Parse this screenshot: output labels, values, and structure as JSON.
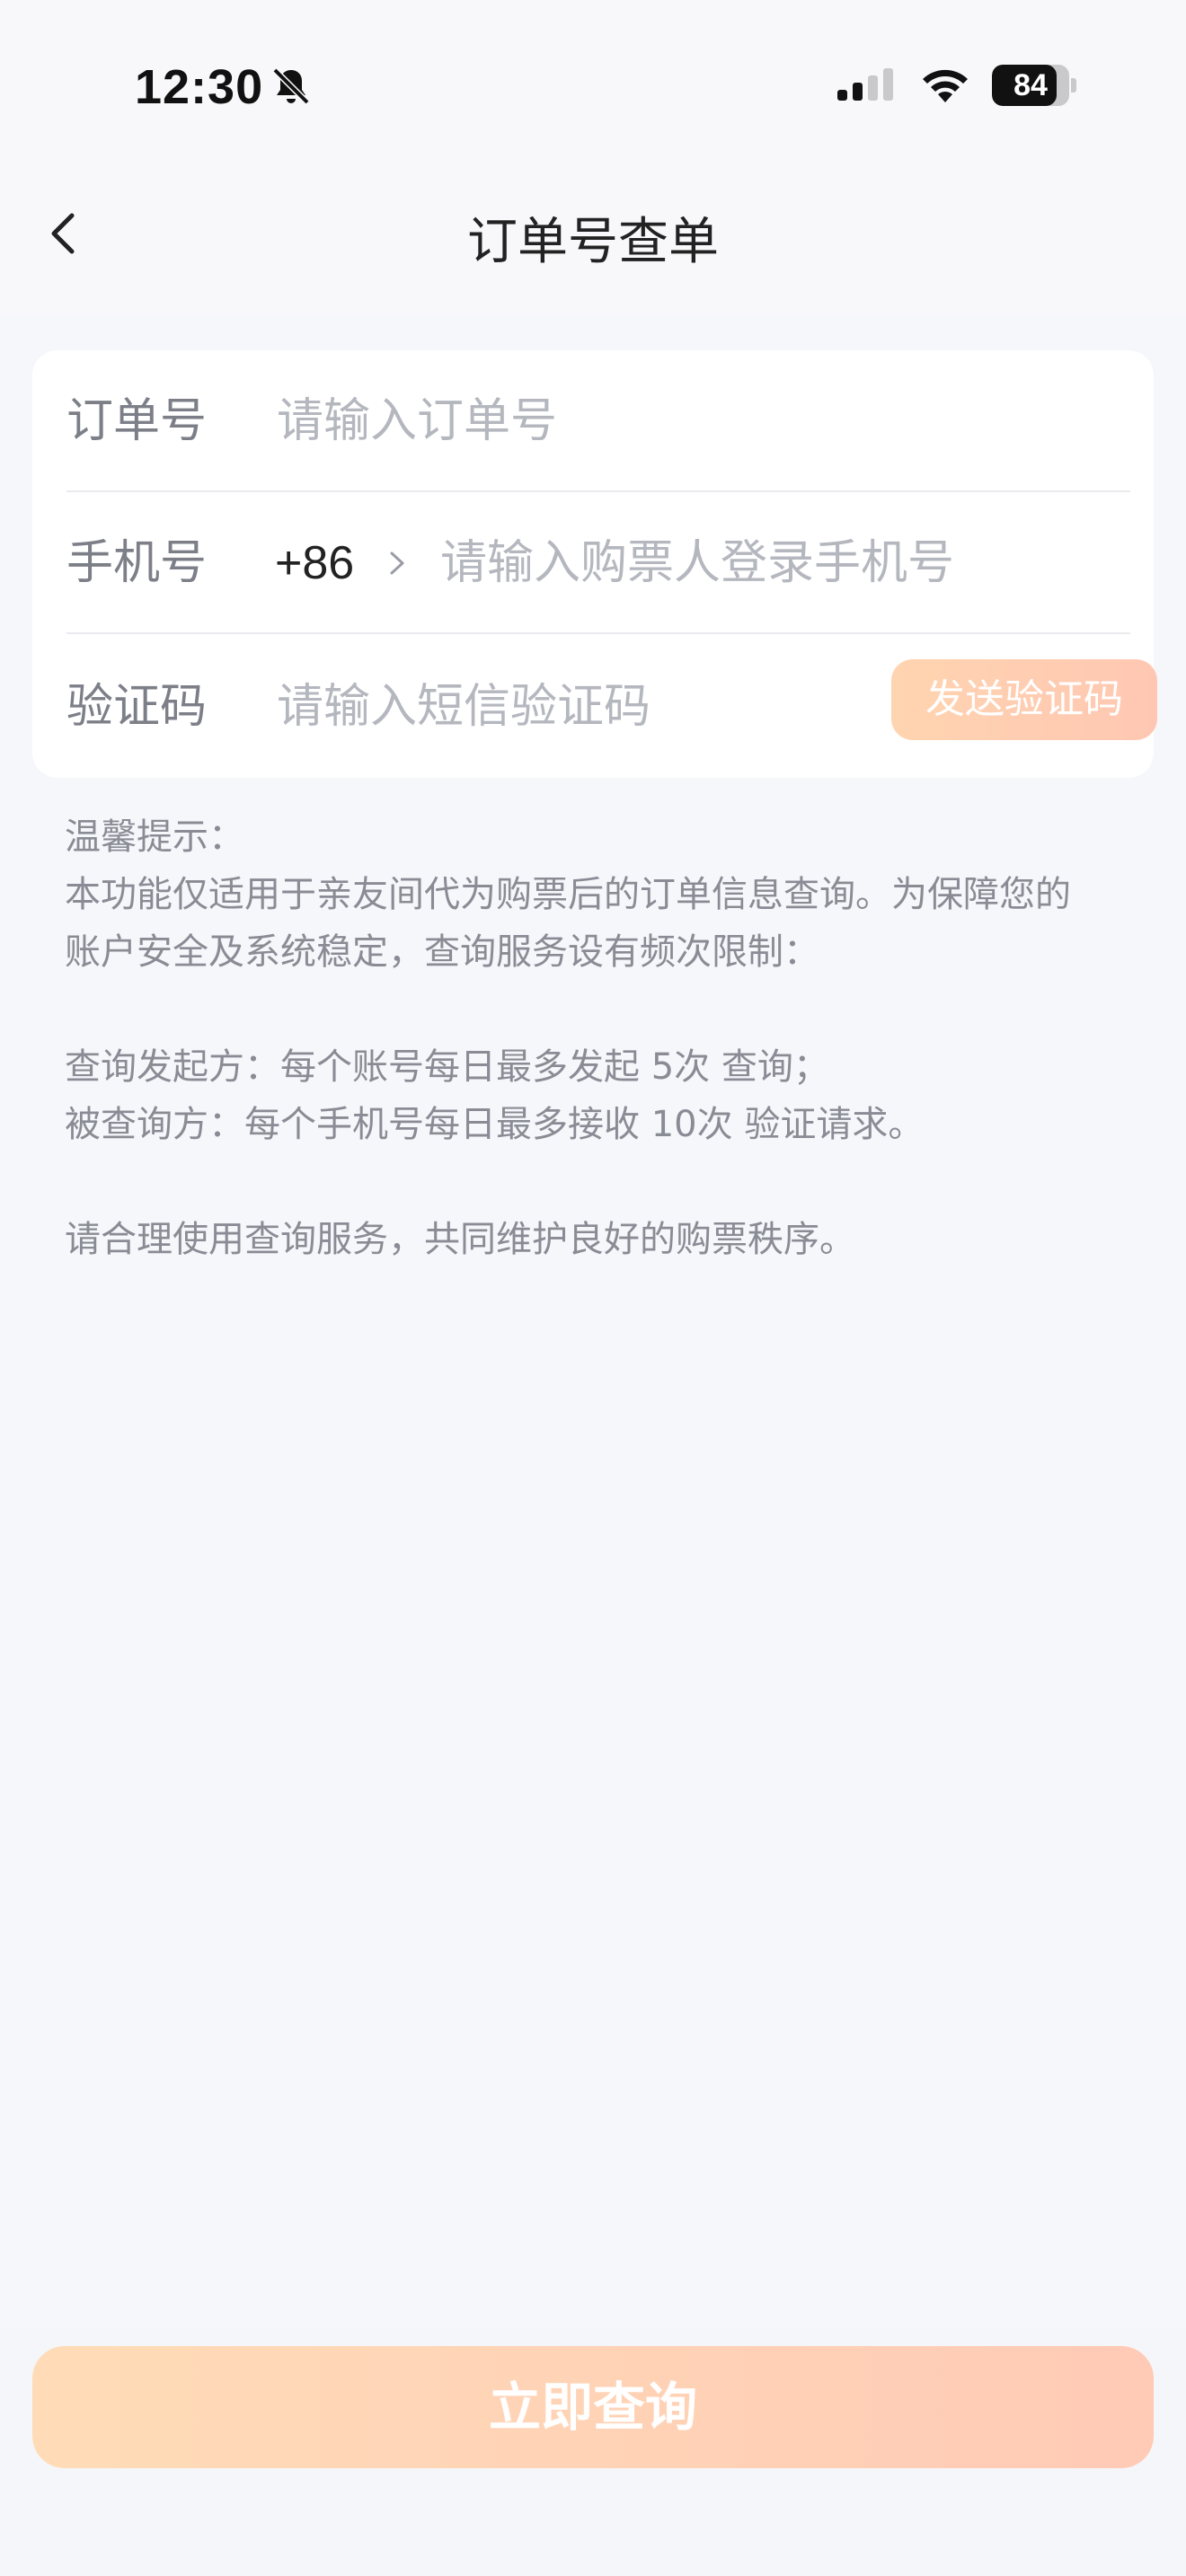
{
  "status_bar": {
    "time": "12:30",
    "battery_percent": 84,
    "battery_text": "84",
    "signal_bars_active": 2,
    "signal_bars_total": 4
  },
  "nav": {
    "title": "订单号查单",
    "back_icon": "chevron-left-icon"
  },
  "form": {
    "order": {
      "label": "订单号",
      "placeholder": "请输入订单号"
    },
    "phone": {
      "label": "手机号",
      "country_code": "+86",
      "placeholder": "请输入购票人登录手机号"
    },
    "code": {
      "label": "验证码",
      "placeholder": "请输入短信验证码",
      "send_button": "发送验证码"
    }
  },
  "tips": {
    "title": "温馨提示：",
    "line1": "本功能仅适用于亲友间代为购票后的订单信息查询。为保障您的",
    "line2": "账户安全及系统稳定，查询服务设有频次限制：",
    "line3": "查询发起方：每个账号每日最多发起 5次 查询；",
    "line4": "被查询方：每个手机号每日最多接收 10次 验证请求。",
    "line5": "请合理使用查询服务，共同维护良好的购票秩序。"
  },
  "actions": {
    "query_button": "立即查询"
  },
  "colors": {
    "accent_start": "#ffdcb7",
    "accent_end": "#ffcab6",
    "background": "#f6f7fb",
    "placeholder": "#b5b7bf",
    "label": "#7d7f88"
  }
}
